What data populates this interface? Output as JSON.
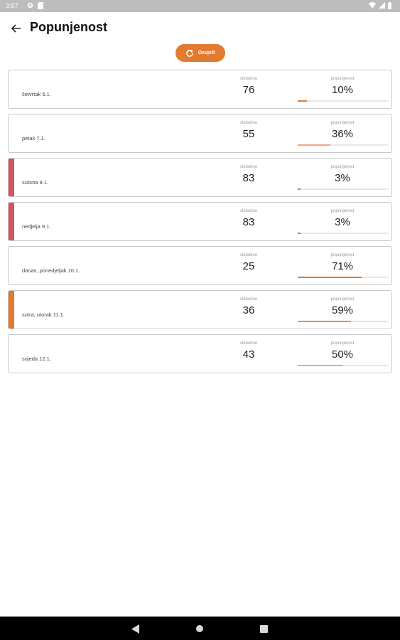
{
  "status_bar": {
    "time": "3:57",
    "icons": [
      "gear-icon",
      "sd-card-icon",
      "wifi-icon",
      "signal-icon",
      "battery-icon"
    ]
  },
  "header": {
    "title": "Popunjenost",
    "back_icon": "arrow-left-icon"
  },
  "refresh_button": {
    "label": "Osvježi",
    "icon": "refresh-icon",
    "color": "#e07b2f"
  },
  "labels": {
    "free": "slobodno",
    "occupancy": "popunjenost"
  },
  "days": [
    {
      "day": "četvrtak 6.1.",
      "free": "76",
      "occupancy": "10%",
      "occupancy_value": 0.1,
      "accent": "",
      "bar_color": "#e07b2f"
    },
    {
      "day": "petak 7.1.",
      "free": "55",
      "occupancy": "36%",
      "occupancy_value": 0.36,
      "accent": "",
      "bar_color": "#f0a586"
    },
    {
      "day": "subota 8.1.",
      "free": "83",
      "occupancy": "3%",
      "occupancy_value": 0.03,
      "accent": "#d1545e",
      "bar_color": "#e07b2f"
    },
    {
      "day": "nedjelja 9.1.",
      "free": "83",
      "occupancy": "3%",
      "occupancy_value": 0.03,
      "accent": "#d1545e",
      "bar_color": "#e07b2f"
    },
    {
      "day": "danas, ponedjeljak 10.1.",
      "free": "25",
      "occupancy": "71%",
      "occupancy_value": 0.71,
      "accent": "",
      "bar_color": "#e07b2f"
    },
    {
      "day": "sutra, utorak 11.1.",
      "free": "36",
      "occupancy": "59%",
      "occupancy_value": 0.59,
      "accent": "#e07b2f",
      "bar_color": "#ec8a5e"
    },
    {
      "day": "srijeda 12.1.",
      "free": "43",
      "occupancy": "50%",
      "occupancy_value": 0.5,
      "accent": "",
      "bar_color": "#f0a586"
    }
  ],
  "nav_bar": {
    "icons": [
      "back-triangle-icon",
      "home-circle-icon",
      "recents-square-icon"
    ]
  }
}
